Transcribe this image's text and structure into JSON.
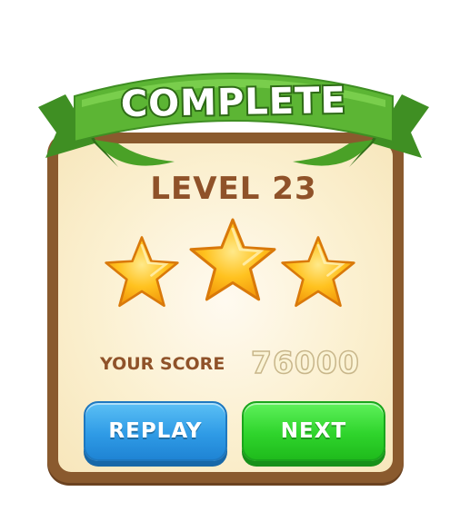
{
  "banner": {
    "title": "COMPLETE"
  },
  "level": {
    "title": "LEVEL 23"
  },
  "stars": {
    "earned": 3,
    "total": 3
  },
  "score": {
    "label": "YOUR SCORE",
    "value": "76000"
  },
  "buttons": {
    "replay_label": "REPLAY",
    "next_label": "NEXT"
  },
  "colors": {
    "banner_green": "#5cb534",
    "card_border": "#8a5a2e",
    "card_fill": "#fbf0d0",
    "level_text": "#8f5229",
    "star_gold": "#ffbe1a",
    "replay_blue": "#2f9be6",
    "next_green": "#2fd42c"
  },
  "icons": {
    "star": "star-icon"
  }
}
